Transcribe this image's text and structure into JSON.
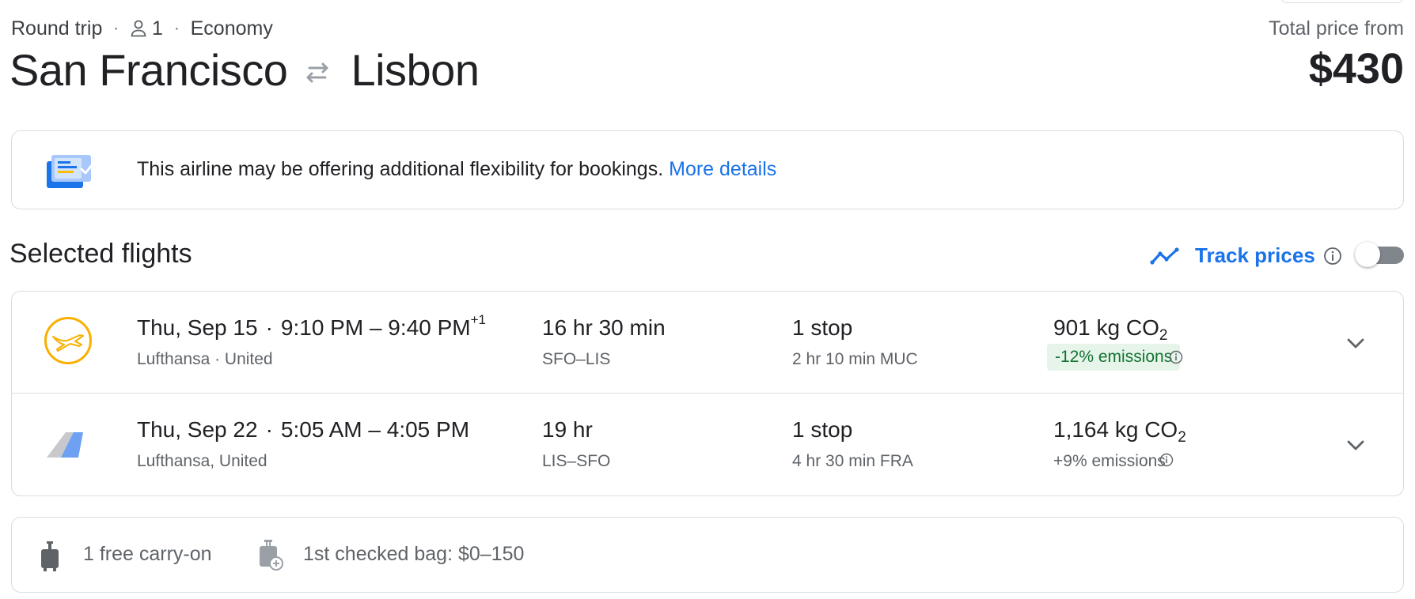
{
  "header": {
    "trip_type": "Round trip",
    "passengers": "1",
    "cabin": "Economy",
    "separator": "·",
    "origin": "San Francisco",
    "destination": "Lisbon",
    "price_label": "Total price from",
    "price": "$430"
  },
  "notice": {
    "text": "This airline may be offering additional flexibility for bookings.",
    "link": "More details"
  },
  "selected": {
    "title": "Selected flights",
    "track_label": "Track prices",
    "track_enabled": false
  },
  "flights": [
    {
      "date": "Thu, Sep 15",
      "separator": "·",
      "times": "9:10 PM – 9:40 PM",
      "day_offset": "+1",
      "airlines": "Lufthansa · United",
      "duration": "16 hr 30 min",
      "route": "SFO–LIS",
      "stops": "1 stop",
      "layover": "2 hr 10 min MUC",
      "co2_value": "901 kg CO",
      "co2_sub": "2",
      "emissions": "-12% emissions",
      "emissions_highlight": true,
      "logo": "lufthansa-logo"
    },
    {
      "date": "Thu, Sep 22",
      "separator": "·",
      "times": "5:05 AM – 4:05 PM",
      "day_offset": "",
      "airlines": "Lufthansa, United",
      "duration": "19 hr",
      "route": "LIS–SFO",
      "stops": "1 stop",
      "layover": "4 hr 30 min FRA",
      "co2_value": "1,164 kg CO",
      "co2_sub": "2",
      "emissions": "+9% emissions",
      "emissions_highlight": false,
      "logo": "multi-airline-tail-logo"
    }
  ],
  "baggage": {
    "carry_on": "1 free carry-on",
    "checked": "1st checked bag: $0–150"
  },
  "colors": {
    "accent": "#1a73e8",
    "border": "#dadce0",
    "emissions_bg": "#e6f4ea",
    "emissions_text": "#137333",
    "lufthansa_yellow": "#f9b000"
  }
}
